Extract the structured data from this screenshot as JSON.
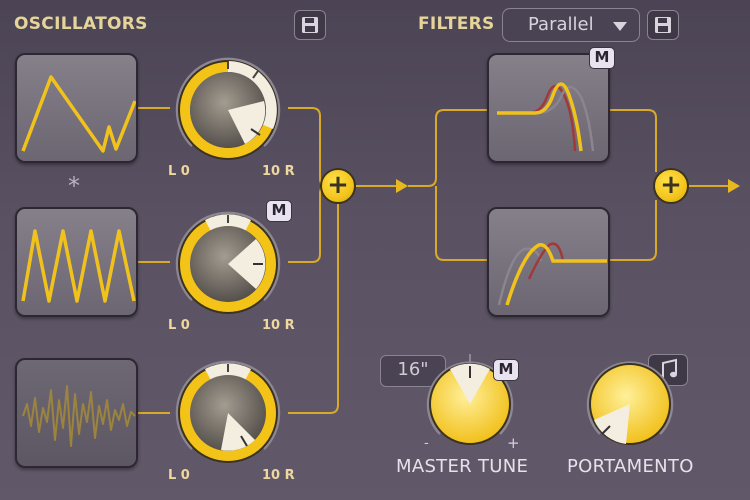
{
  "oscillators": {
    "title": "OSCILLATORS",
    "link_symbol": "*",
    "range_left": "L 0",
    "range_right": "10 R",
    "modulation_badge": "M"
  },
  "filters": {
    "title": "FILTERS",
    "mode_selected": "Parallel",
    "modulation_badge": "M"
  },
  "master_tune": {
    "label": "MASTER TUNE",
    "value": "16\"",
    "minus": "-",
    "plus": "+",
    "modulation_badge": "M"
  },
  "portamento": {
    "label": "PORTAMENTO"
  },
  "mixer": {
    "plus_symbol": "+"
  },
  "colors": {
    "accent": "#f5c518",
    "label": "#e6d49a",
    "panel": "#7a7580"
  },
  "icons": [
    "save-icon",
    "music-note-icon",
    "dropdown-caret-icon"
  ]
}
